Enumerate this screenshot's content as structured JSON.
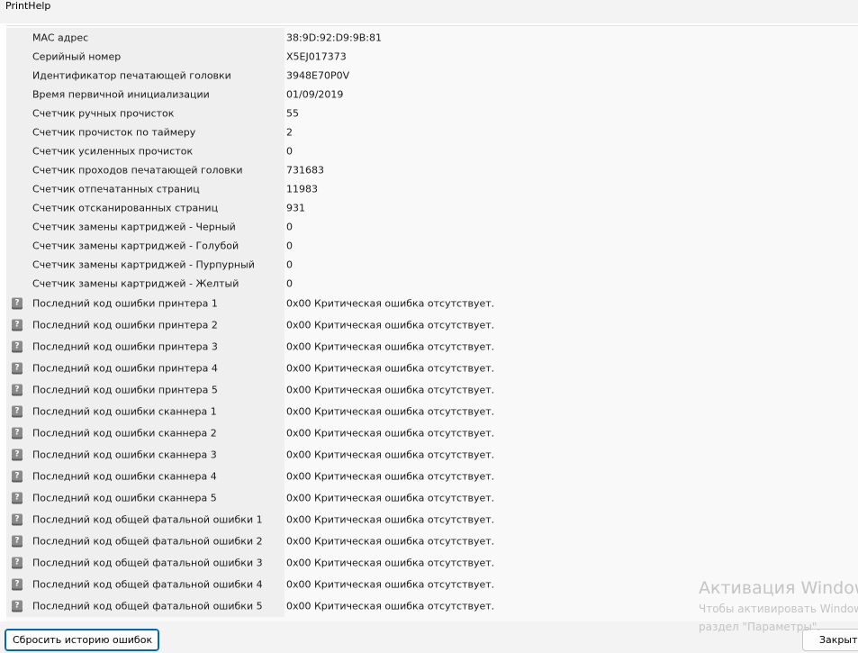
{
  "window": {
    "title": "PrintHelp"
  },
  "info_rows": [
    {
      "label": "MAC адрес",
      "value": "38:9D:92:D9:9B:81"
    },
    {
      "label": "Серийный номер",
      "value": "X5EJ017373"
    },
    {
      "label": "Идентификатор печатающей головки",
      "value": "3948E70P0V"
    },
    {
      "label": "Время первичной инициализации",
      "value": "01/09/2019"
    },
    {
      "label": "Счетчик ручных прочисток",
      "value": "55"
    },
    {
      "label": "Счетчик прочисток по таймеру",
      "value": "2"
    },
    {
      "label": "Счетчик усиленных прочисток",
      "value": "0"
    },
    {
      "label": "Счетчик проходов печатающей головки",
      "value": "731683"
    },
    {
      "label": "Счетчик отпечатанных страниц",
      "value": "11983"
    },
    {
      "label": "Счетчик отсканированных страниц",
      "value": "931"
    },
    {
      "label": "Счетчик замены картриджей - Черный",
      "value": "0"
    },
    {
      "label": "Счетчик замены картриджей - Голубой",
      "value": "0"
    },
    {
      "label": "Счетчик замены картриджей - Пурпурный",
      "value": "0"
    },
    {
      "label": "Счетчик замены картриджей - Желтый",
      "value": "0"
    }
  ],
  "error_icon_glyph": "?",
  "error_rows": [
    {
      "label": "Последний код ошибки принтера 1",
      "value": "0x00 Критическая ошибка отсутствует."
    },
    {
      "label": "Последний код ошибки принтера 2",
      "value": "0x00 Критическая ошибка отсутствует."
    },
    {
      "label": "Последний код ошибки принтера 3",
      "value": "0x00 Критическая ошибка отсутствует."
    },
    {
      "label": "Последний код ошибки принтера 4",
      "value": "0x00 Критическая ошибка отсутствует."
    },
    {
      "label": "Последний код ошибки принтера 5",
      "value": "0x00 Критическая ошибка отсутствует."
    },
    {
      "label": "Последний код ошибки сканнера 1",
      "value": "0x00 Критическая ошибка отсутствует."
    },
    {
      "label": "Последний код ошибки сканнера 2",
      "value": "0x00 Критическая ошибка отсутствует."
    },
    {
      "label": "Последний код ошибки сканнера 3",
      "value": "0x00 Критическая ошибка отсутствует."
    },
    {
      "label": "Последний код ошибки сканнера 4",
      "value": "0x00 Критическая ошибка отсутствует."
    },
    {
      "label": "Последний код ошибки сканнера 5",
      "value": "0x00 Критическая ошибка отсутствует."
    },
    {
      "label": "Последний код общей фатальной ошибки 1",
      "value": "0x00 Критическая ошибка отсутствует."
    },
    {
      "label": "Последний код общей фатальной ошибки 2",
      "value": "0x00 Критическая ошибка отсутствует."
    },
    {
      "label": "Последний код общей фатальной ошибки 3",
      "value": "0x00 Критическая ошибка отсутствует."
    },
    {
      "label": "Последний код общей фатальной ошибки 4",
      "value": "0x00 Критическая ошибка отсутствует."
    },
    {
      "label": "Последний код общей фатальной ошибки 5",
      "value": "0x00 Критическая ошибка отсутствует."
    }
  ],
  "buttons": {
    "reset_label": "Сбросить историю ошибок",
    "close_label": "Закрыть"
  },
  "watermark": {
    "line1": "Активация Windows",
    "line2": "Чтобы активировать Windows, перейдите в",
    "line3": "раздел \"Параметры\"."
  }
}
